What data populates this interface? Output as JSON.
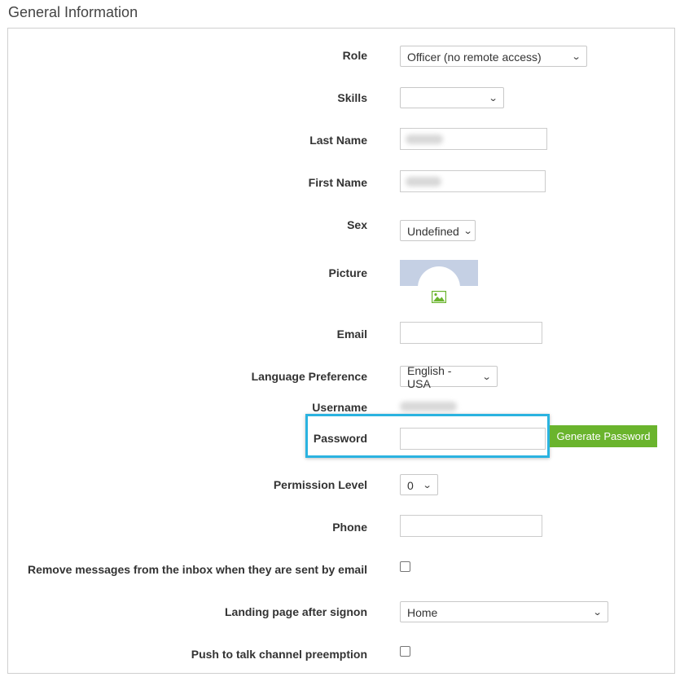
{
  "section": {
    "title": "General Information"
  },
  "fields": {
    "role": {
      "label": "Role",
      "value": "Officer (no remote access)"
    },
    "skills": {
      "label": "Skills",
      "value": ""
    },
    "last_name": {
      "label": "Last Name",
      "value": ""
    },
    "first_name": {
      "label": "First Name",
      "value": ""
    },
    "sex": {
      "label": "Sex",
      "value": "Undefined"
    },
    "picture": {
      "label": "Picture",
      "change_icon": "image-icon"
    },
    "email": {
      "label": "Email",
      "value": ""
    },
    "language": {
      "label": "Language Preference",
      "value": "English - USA"
    },
    "username": {
      "label": "Username",
      "value": ""
    },
    "password": {
      "label": "Password",
      "value": "",
      "generate_label": "Generate Password"
    },
    "permission_level": {
      "label": "Permission Level",
      "value": "0"
    },
    "phone": {
      "label": "Phone",
      "value": ""
    },
    "remove_messages": {
      "label": "Remove messages from the inbox when they are sent by email",
      "checked": false
    },
    "landing_page": {
      "label": "Landing page after signon",
      "value": "Home"
    },
    "ptt_preemption": {
      "label": "Push to talk channel preemption",
      "checked": false
    }
  },
  "colors": {
    "highlight": "#2bb3e0",
    "button_green": "#6ab42d",
    "avatar_bg": "#c5d0e4"
  }
}
